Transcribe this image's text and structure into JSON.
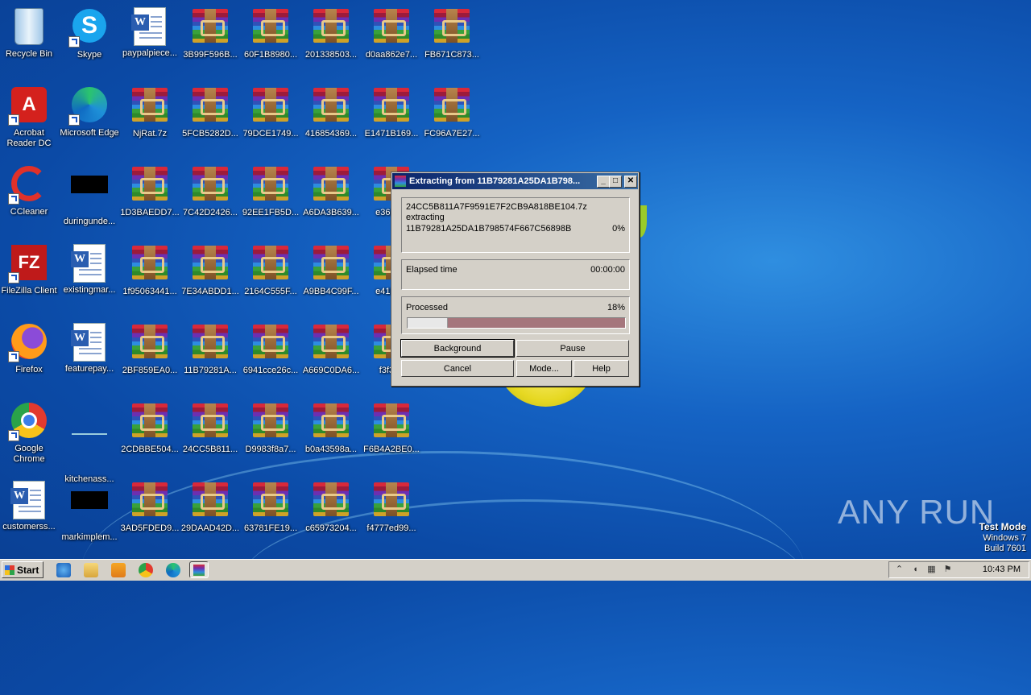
{
  "desktop": {
    "icons": [
      {
        "label": "Recycle Bin"
      },
      {
        "label": "Skype"
      },
      {
        "label": "paypalpiece..."
      },
      {
        "label": "3B99F596B..."
      },
      {
        "label": "60F1B8980..."
      },
      {
        "label": "201338503..."
      },
      {
        "label": "d0aa862e7..."
      },
      {
        "label": "FB671C873..."
      },
      {
        "label": "Acrobat Reader DC"
      },
      {
        "label": "Microsoft Edge"
      },
      {
        "label": "NjRat.7z"
      },
      {
        "label": "5FCB5282D..."
      },
      {
        "label": "79DCE1749..."
      },
      {
        "label": "416854369..."
      },
      {
        "label": "E1471B169..."
      },
      {
        "label": "FC96A7E27..."
      },
      {
        "label": "CCleaner"
      },
      {
        "label": "duringunde..."
      },
      {
        "label": "1D3BAEDD7..."
      },
      {
        "label": "7C42D2426..."
      },
      {
        "label": "92EE1FB5D..."
      },
      {
        "label": "A6DA3B639..."
      },
      {
        "label": "e3612..."
      },
      {
        "label": "FileZilla Client"
      },
      {
        "label": "existingmar..."
      },
      {
        "label": "1f95063441..."
      },
      {
        "label": "7E34ABDD1..."
      },
      {
        "label": "2164C555F..."
      },
      {
        "label": "A9BB4C99F..."
      },
      {
        "label": "e4194..."
      },
      {
        "label": "Firefox"
      },
      {
        "label": "featurepay..."
      },
      {
        "label": "2BF859EA0..."
      },
      {
        "label": "11B79281A..."
      },
      {
        "label": "6941cce26c..."
      },
      {
        "label": "A669C0DA6..."
      },
      {
        "label": "f3f3f..."
      },
      {
        "label": "Google Chrome"
      },
      {
        "label": "kitchenass..."
      },
      {
        "label": "2CDBBE504..."
      },
      {
        "label": "24CC5B811..."
      },
      {
        "label": "D9983f8a7..."
      },
      {
        "label": "b0a43598a..."
      },
      {
        "label": "F6B4A2BE0..."
      },
      {
        "label": "customerss..."
      },
      {
        "label": "markimplem..."
      },
      {
        "label": "3AD5FDED9..."
      },
      {
        "label": "29DAAD42D..."
      },
      {
        "label": "63781FE19..."
      },
      {
        "label": "c65973204..."
      },
      {
        "label": "f4777ed99..."
      }
    ]
  },
  "dialog": {
    "title": "Extracting from 11B79281A25DA1B798...",
    "archive": "24CC5B811A7F9591E7F2CB9A818BE104.7z",
    "action": "extracting",
    "file": "11B79281A25DA1B798574F667C56898B",
    "file_percent": "0%",
    "elapsed_label": "Elapsed time",
    "elapsed_value": "00:00:00",
    "processed_label": "Processed",
    "processed_percent": "18%",
    "progress_fraction": 0.18,
    "buttons": {
      "background": "Background",
      "pause": "Pause",
      "cancel": "Cancel",
      "mode": "Mode...",
      "help": "Help"
    },
    "minimize_glyph": "_",
    "maximize_glyph": "□",
    "close_glyph": "✕"
  },
  "taskbar": {
    "start_label": "Start",
    "clock": "10:43 PM",
    "tray_up_glyph": "⌃"
  },
  "watermark": {
    "text": "ANY RUN"
  },
  "test_mode": {
    "line1": "Test Mode",
    "line2": "Windows 7",
    "line3": "Build 7601"
  }
}
